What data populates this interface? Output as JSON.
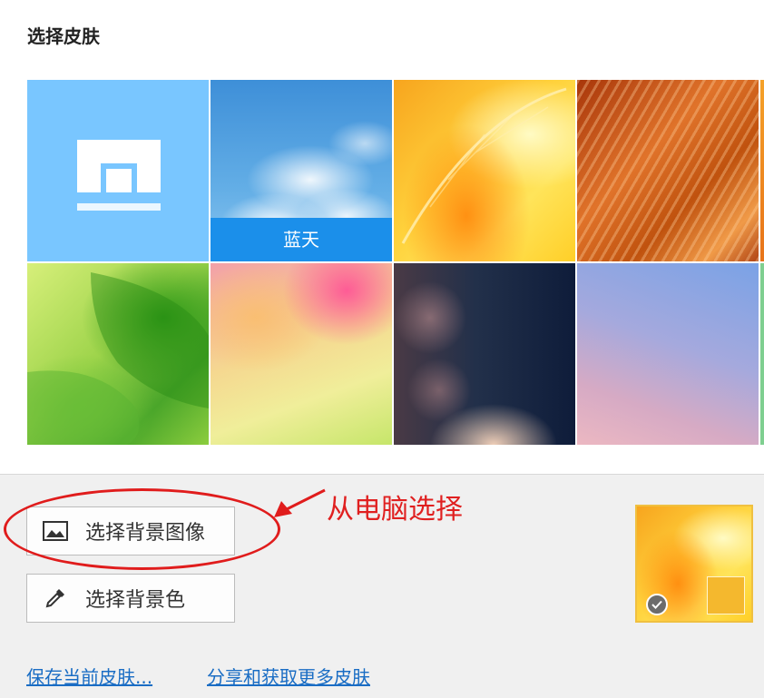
{
  "header": {
    "title": "选择皮肤"
  },
  "skins": [
    {
      "name": "maxthon-logo",
      "label": ""
    },
    {
      "name": "blue-sky",
      "label": "蓝天",
      "selected_hover": true
    },
    {
      "name": "orange-leaf",
      "label": ""
    },
    {
      "name": "copper-waves",
      "label": ""
    },
    {
      "name": "green-leaves",
      "label": ""
    },
    {
      "name": "pink-yellow",
      "label": ""
    },
    {
      "name": "dark-bokeh",
      "label": ""
    },
    {
      "name": "purple-gradient",
      "label": ""
    }
  ],
  "actions": {
    "choose_bg_image": "选择背景图像",
    "choose_bg_color": "选择背景色",
    "choose_bg_image_icon": "image-icon",
    "choose_bg_color_icon": "eyedropper-icon"
  },
  "annotation": {
    "text": "从电脑选择",
    "color": "#e02020"
  },
  "preview": {
    "swatch_color": "#f4b82e",
    "check_icon": "check-icon"
  },
  "links": {
    "save_current": "保存当前皮肤...",
    "share_more": "分享和获取更多皮肤"
  },
  "colors": {
    "accent": "#1b8fea",
    "link": "#1a6dc4",
    "panel_bg": "#f0f0f0"
  }
}
